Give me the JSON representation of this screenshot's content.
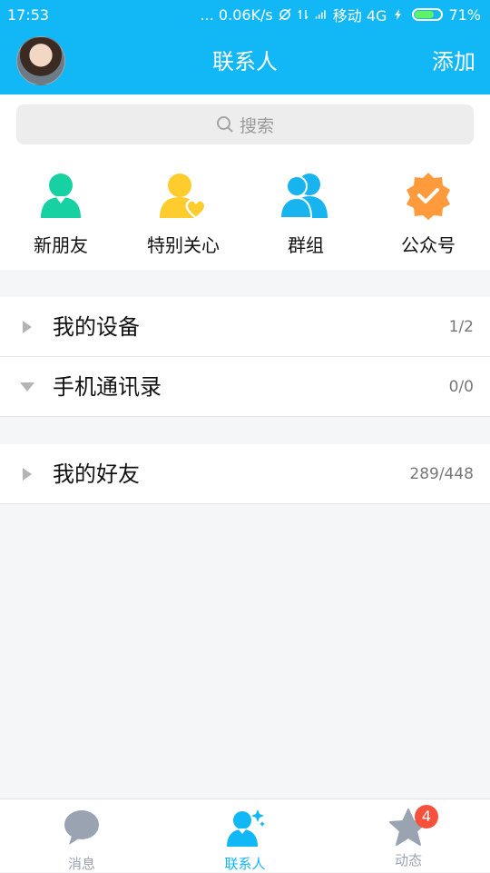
{
  "status_bar": {
    "time": "17:53",
    "network_speed": "... 0.06K/s",
    "carrier": "移动 4G",
    "battery": "71%"
  },
  "header": {
    "title": "联系人",
    "add_label": "添加"
  },
  "search": {
    "placeholder": "搜索"
  },
  "quick_entries": [
    {
      "label": "新朋友",
      "icon": "person-add-icon",
      "color": "#18d1a2"
    },
    {
      "label": "特别关心",
      "icon": "person-heart-icon",
      "color": "#ffcc2e"
    },
    {
      "label": "群组",
      "icon": "group-icon",
      "color": "#18b4f0"
    },
    {
      "label": "公众号",
      "icon": "badge-check-icon",
      "color": "#ff9a3d"
    }
  ],
  "groups": [
    {
      "name": "我的设备",
      "count": "1/2",
      "expanded": false
    },
    {
      "name": "手机通讯录",
      "count": "0/0",
      "expanded": true
    },
    {
      "name": "我的好友",
      "count": "289/448",
      "expanded": false
    }
  ],
  "tabs": [
    {
      "label": "消息",
      "icon": "chat-bubble-icon",
      "active": false
    },
    {
      "label": "联系人",
      "icon": "contacts-icon",
      "active": true
    },
    {
      "label": "动态",
      "icon": "star-icon",
      "active": false,
      "badge": "4"
    }
  ],
  "colors": {
    "brand": "#12b7f5",
    "inactive_tab": "#9aa3b2",
    "badge": "#f7503b"
  }
}
